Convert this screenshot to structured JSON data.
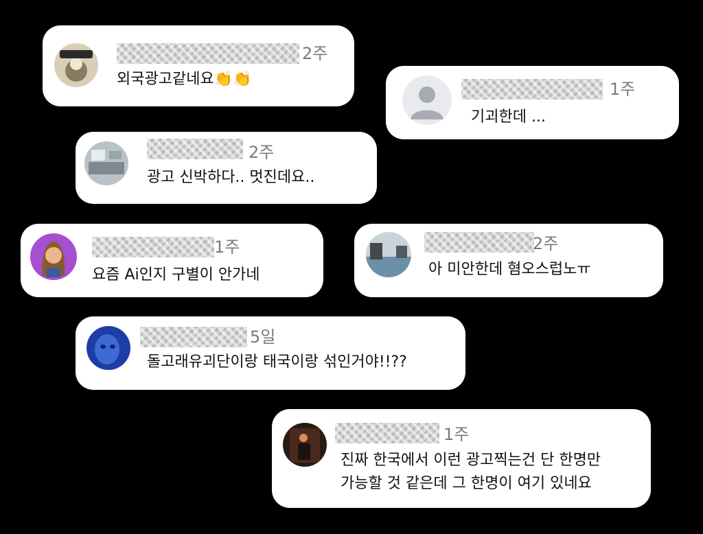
{
  "comments": [
    {
      "time": "2주",
      "text": "외국광고같네요",
      "emoji": "👏👏",
      "avatar": "avatar-badge-illustration"
    },
    {
      "time": "1주",
      "text": "기괴한데 ...",
      "avatar": "default-user-icon"
    },
    {
      "time": "2주",
      "text": "광고 신박하다.. 멋진데요..",
      "avatar": "avatar-room-photo"
    },
    {
      "time": "1주",
      "text": "요즘 Ai인지 구별이 안가네",
      "avatar": "avatar-memoji"
    },
    {
      "time": "2주",
      "text": "아 미안한데 혐오스럽노ㅠ",
      "avatar": "avatar-pool-photo"
    },
    {
      "time": "5일",
      "text": "돌고래유괴단이랑 태국이랑 섞인거야!!??",
      "avatar": "avatar-blue-photo"
    },
    {
      "time": "1주",
      "line1": "진짜 한국에서 이런 광고찍는건 단 한명만",
      "line2": "가능할 것 같은데 그 한명이 여기 있네요",
      "avatar": "avatar-dark-photo"
    }
  ],
  "colors": {
    "background": "#000000",
    "card": "#ffffff",
    "timestamp": "#7a7a7a",
    "text": "#111111",
    "username_blur": "#cfcfcf"
  }
}
